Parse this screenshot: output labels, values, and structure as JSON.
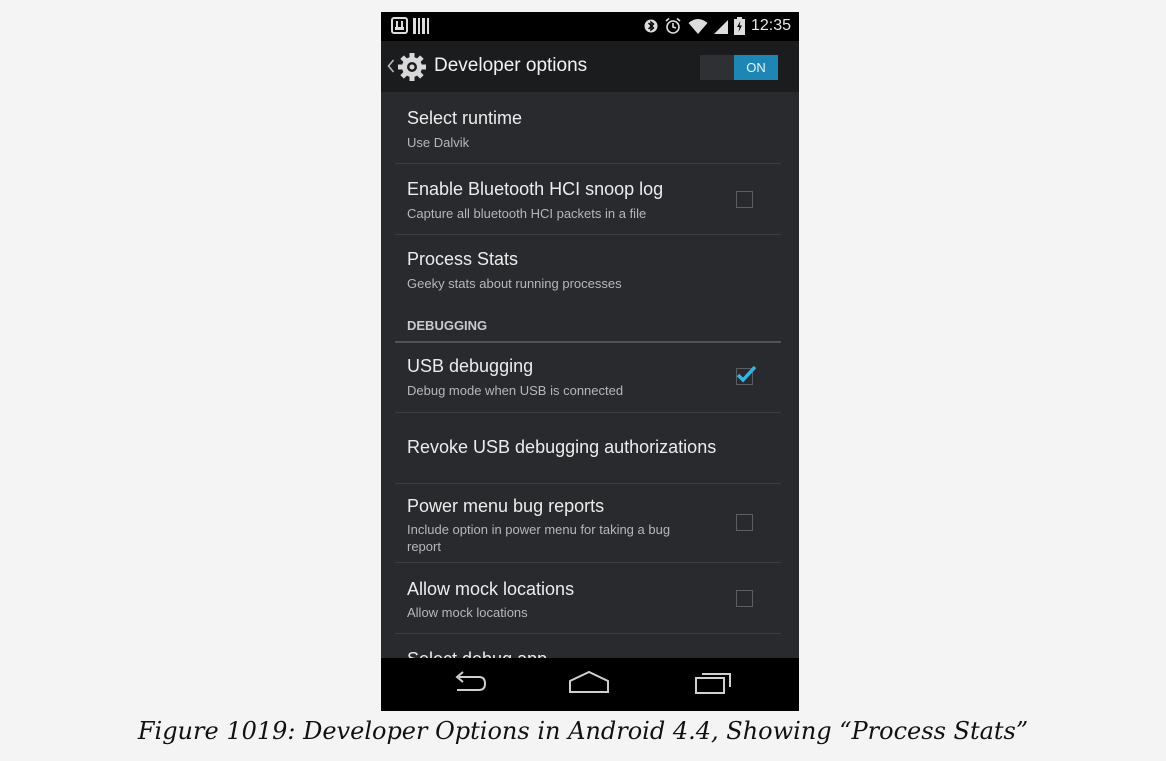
{
  "status_bar": {
    "time": "12:35",
    "icons": [
      "notification-icon",
      "barcode-icon",
      "bluetooth-icon",
      "alarm-icon",
      "wifi-icon",
      "signal-icon",
      "battery-icon"
    ]
  },
  "action_bar": {
    "title": "Developer options",
    "toggle_label": "ON",
    "toggle_color": "#1d86b5"
  },
  "preferences": [
    {
      "title": "Select runtime",
      "summary": "Use Dalvik"
    },
    {
      "title": "Enable Bluetooth HCI snoop log",
      "summary": "Capture all bluetooth HCI packets in a file",
      "checked": false
    },
    {
      "title": "Process Stats",
      "summary": "Geeky stats about running processes"
    },
    {
      "title": "USB debugging",
      "summary": "Debug mode when USB is connected",
      "checked": true
    },
    {
      "title": "Revoke USB debugging authorizations"
    },
    {
      "title": "Power menu bug reports",
      "summary": "Include option in power menu for taking a bug report",
      "checked": false
    },
    {
      "title": "Allow mock locations",
      "summary": "Allow mock locations",
      "checked": false
    },
    {
      "title": "Select debug app"
    }
  ],
  "section_header": "DEBUGGING",
  "caption": "Figure 1019: Developer Options in Android 4.4, Showing “Process Stats”",
  "colors": {
    "checkbox_checked": "#33b5e5",
    "background": "#282a2d"
  }
}
